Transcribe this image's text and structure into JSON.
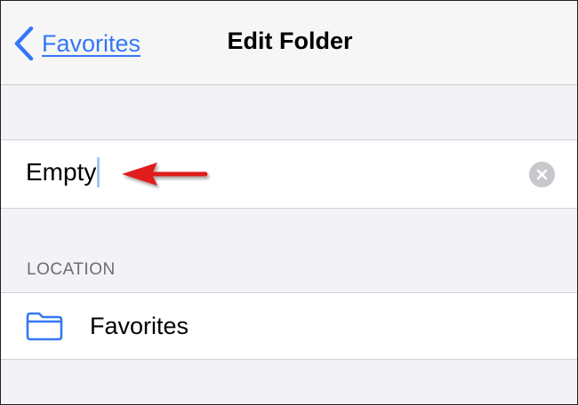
{
  "navbar": {
    "back_label": "Favorites",
    "title": "Edit Folder"
  },
  "folder_name": {
    "value": "Empty"
  },
  "location": {
    "section_header": "LOCATION",
    "folder_label": "Favorites"
  },
  "colors": {
    "accent": "#3478f6",
    "annotation_arrow": "#e01a1a",
    "clear_button": "#c7c7cc"
  },
  "icons": {
    "back": "chevron-left-icon",
    "clear": "clear-icon",
    "folder": "folder-icon",
    "annotation": "red-arrow-icon"
  }
}
